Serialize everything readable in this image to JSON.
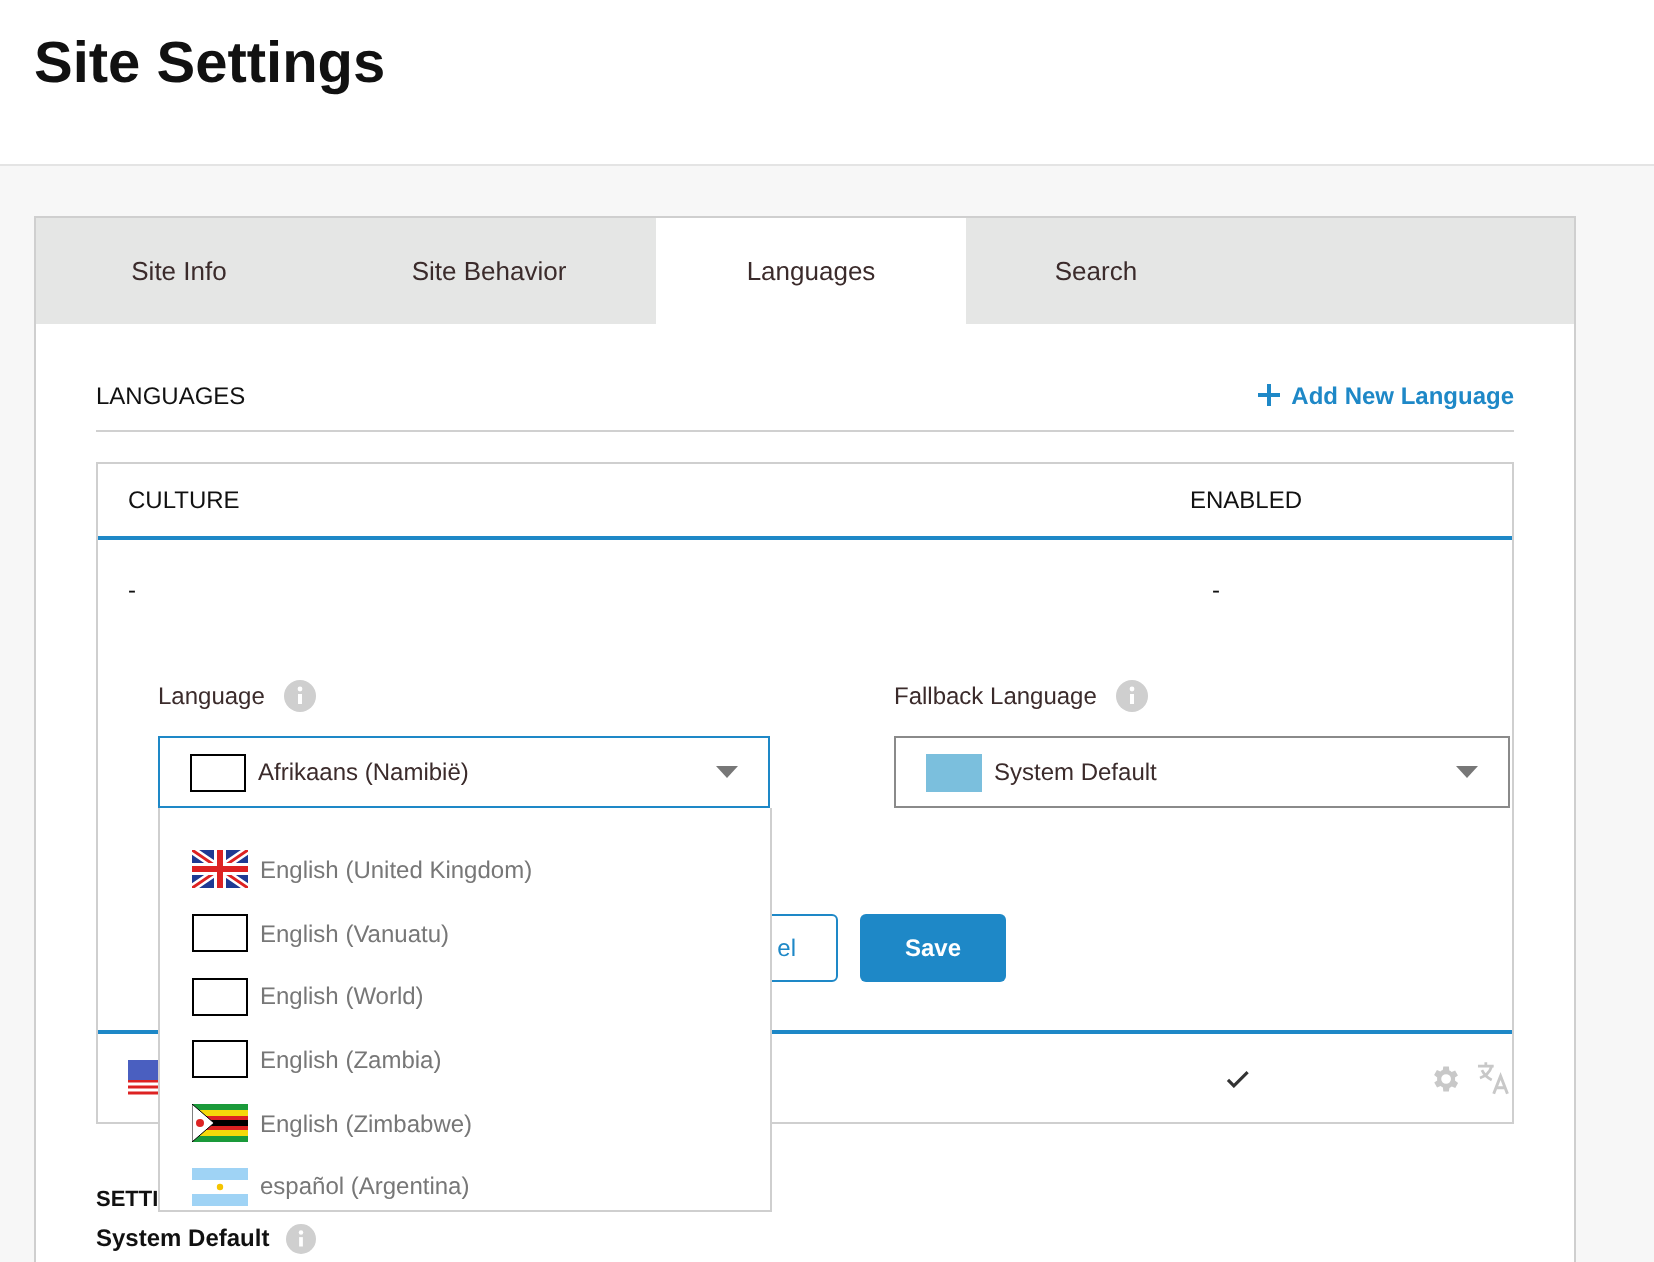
{
  "page_title": "Site Settings",
  "tabs": [
    {
      "label": "Site Info",
      "selected": false
    },
    {
      "label": "Site Behavior",
      "selected": false
    },
    {
      "label": "Languages",
      "selected": true
    },
    {
      "label": "Search",
      "selected": false
    }
  ],
  "section_title": "LANGUAGES",
  "add_button": "Add New Language",
  "table": {
    "columns": [
      "CULTURE",
      "ENABLED"
    ],
    "rows": [
      {
        "culture": "-",
        "enabled": "-"
      }
    ],
    "edit_form": {
      "language": {
        "label": "Language",
        "value": "Afrikaans (Namibië)",
        "kind": "blank"
      },
      "fallback": {
        "label": "Fallback Language",
        "value": "System Default",
        "kind": "swatch"
      },
      "cancel_label": "el",
      "save_label": "Save",
      "dropdown": {
        "expanded": true,
        "options": [
          {
            "label": "English (United Kingdom)",
            "kind": "uk"
          },
          {
            "label": "English (Vanuatu)",
            "kind": "blank"
          },
          {
            "label": "English (World)",
            "kind": "blank"
          },
          {
            "label": "English (Zambia)",
            "kind": "blank"
          },
          {
            "label": "English (Zimbabwe)",
            "kind": "zimbabwe"
          },
          {
            "label": "español (Argentina)",
            "kind": "argentina"
          }
        ]
      }
    },
    "lower_rows": [
      {
        "kind": "us",
        "enabled": true
      }
    ]
  },
  "settings": {
    "heading": "SETTI",
    "rows": [
      {
        "label": "System Default"
      }
    ]
  }
}
